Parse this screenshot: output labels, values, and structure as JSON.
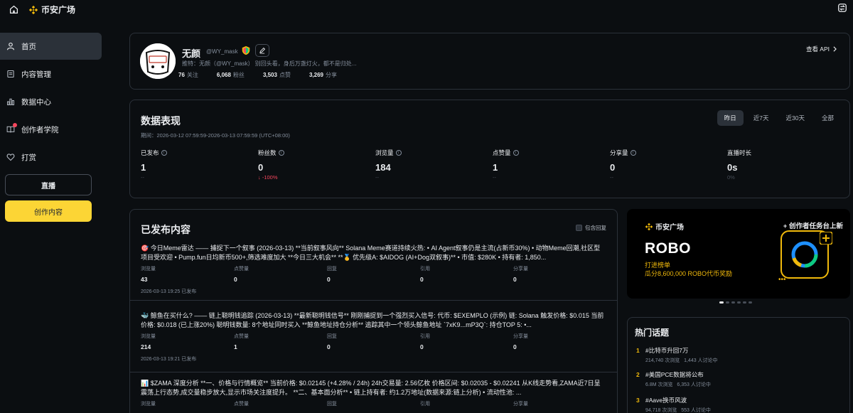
{
  "app": {
    "logo_text": "币安广场",
    "accent": "#f0b90b"
  },
  "sidebar": {
    "items": [
      {
        "label": "首页",
        "icon": "user-icon",
        "active": true
      },
      {
        "label": "内容管理",
        "icon": "document-icon"
      },
      {
        "label": "数据中心",
        "icon": "bar-chart-icon"
      },
      {
        "label": "创作者学院",
        "icon": "book-icon",
        "dot": true
      },
      {
        "label": "打赏",
        "icon": "heart-icon"
      }
    ],
    "live_label": "直播",
    "create_label": "创作内容"
  },
  "profile": {
    "name": "无颜",
    "handle": "@WY_mask",
    "avatar_text": "無顏",
    "bio": "推特：无颜（@WY_mask） 别回头看，身后万盏灯火，都不是归处...",
    "stats": [
      {
        "value": "76",
        "label": "关注"
      },
      {
        "value": "6,068",
        "label": "粉丝"
      },
      {
        "value": "3,503",
        "label": "点赞"
      },
      {
        "value": "3,269",
        "label": "分享"
      }
    ],
    "api_link": "查看 API"
  },
  "performance": {
    "title": "数据表现",
    "period": "期间：2026-03-12 07:59:59-2026-03-13 07:59:59 (UTC+08:00)",
    "tabs": [
      "昨日",
      "近7天",
      "近30天",
      "全部"
    ],
    "active_tab": 0,
    "metrics": [
      {
        "label": "已发布",
        "value": "1",
        "sub": "--",
        "info": true
      },
      {
        "label": "粉丝数",
        "value": "0",
        "sub": "↓ -100%",
        "info": true,
        "negative": true
      },
      {
        "label": "浏览量",
        "value": "184",
        "sub": "--",
        "info": true
      },
      {
        "label": "点赞量",
        "value": "1",
        "sub": "--",
        "info": true
      },
      {
        "label": "分享量",
        "value": "0",
        "sub": "--",
        "info": true
      },
      {
        "label": "直播时长",
        "value": "0s",
        "sub": "0%",
        "info": false
      }
    ]
  },
  "published": {
    "title": "已发布内容",
    "include_replies": "包含回复",
    "stat_labels": [
      "浏览量",
      "点赞量",
      "回复",
      "引用",
      "分享量"
    ],
    "posts": [
      {
        "text": "🎯 今日Meme雷达 —— 捕捉下一个叙事 (2026-03-13) **当前叙事风向** Solana Meme赛道持续火热: • AI Agent叙事仍是主流(占新币30%) • 动物Meme回潮,社区型项目受欢迎 • Pump.fun日均新币500+,筛选难度加大 **今日三大机会** **🥇 优先级A: $AIDOG (AI+Dog双叙事)** • 市值: $280K • 持有者: 1,850...",
        "stats": [
          "43",
          "0",
          "0",
          "0",
          "0"
        ],
        "time": "2026-03-13 19:25 已发布"
      },
      {
        "text": "🐳 鲸鱼在买什么? —— 链上聪明钱追踪 (2026-03-13) **最新聪明钱信号** 刚刚捕捉到一个强烈买入信号: 代币: $EXEMPLO (示例) 链: Solana 触发价格: $0.015 当前价格: $0.018 (已上涨20%) 聪明钱数量: 8个地址同时买入 **鲸鱼地址持仓分析** 追踪其中一个领头鲸鱼地址 `7xK9...mP3Q`: 持仓TOP 5: •...",
        "stats": [
          "214",
          "1",
          "0",
          "0",
          "0"
        ],
        "time": "2026-03-13 19:21 已发布"
      },
      {
        "text": "📊 $ZAMA 深度分析 **一、价格与行情概览** 当前价格: $0.02145 (+4.28% / 24h) 24h交易量: 2.56亿枚 价格区间: $0.02035 - $0.02241 从K线走势看,ZAMA近7日呈震荡上行态势,成交量稳步放大,显示市场关注度提升。 **二、基本面分析** • 链上持有者: 约1.2万地址(数据来源:链上分析) • 流动性池: ...",
        "stats": [
          "",
          "",
          "",
          "",
          ""
        ],
        "time": ""
      }
    ]
  },
  "banner": {
    "logo_text": "币安广场",
    "tag": "创作者任务台上新",
    "title": "ROBO",
    "line1": "打进榜单",
    "line2": "瓜分8,600,000 ROBO代币奖励",
    "dots": 6,
    "active_dot": 0
  },
  "hot_topics": {
    "title": "热门话题",
    "items": [
      {
        "rank": "1",
        "name": "#比特币升回7万",
        "views": "214,740 次浏览",
        "discussing": "1,443 人讨论中"
      },
      {
        "rank": "2",
        "name": "#美国PCE数据将公布",
        "views": "6.8M 次浏览",
        "discussing": "6,353 人讨论中"
      },
      {
        "rank": "3",
        "name": "#Aave换币风波",
        "views": "94,718 次浏览",
        "discussing": "553 人讨论中"
      }
    ]
  }
}
